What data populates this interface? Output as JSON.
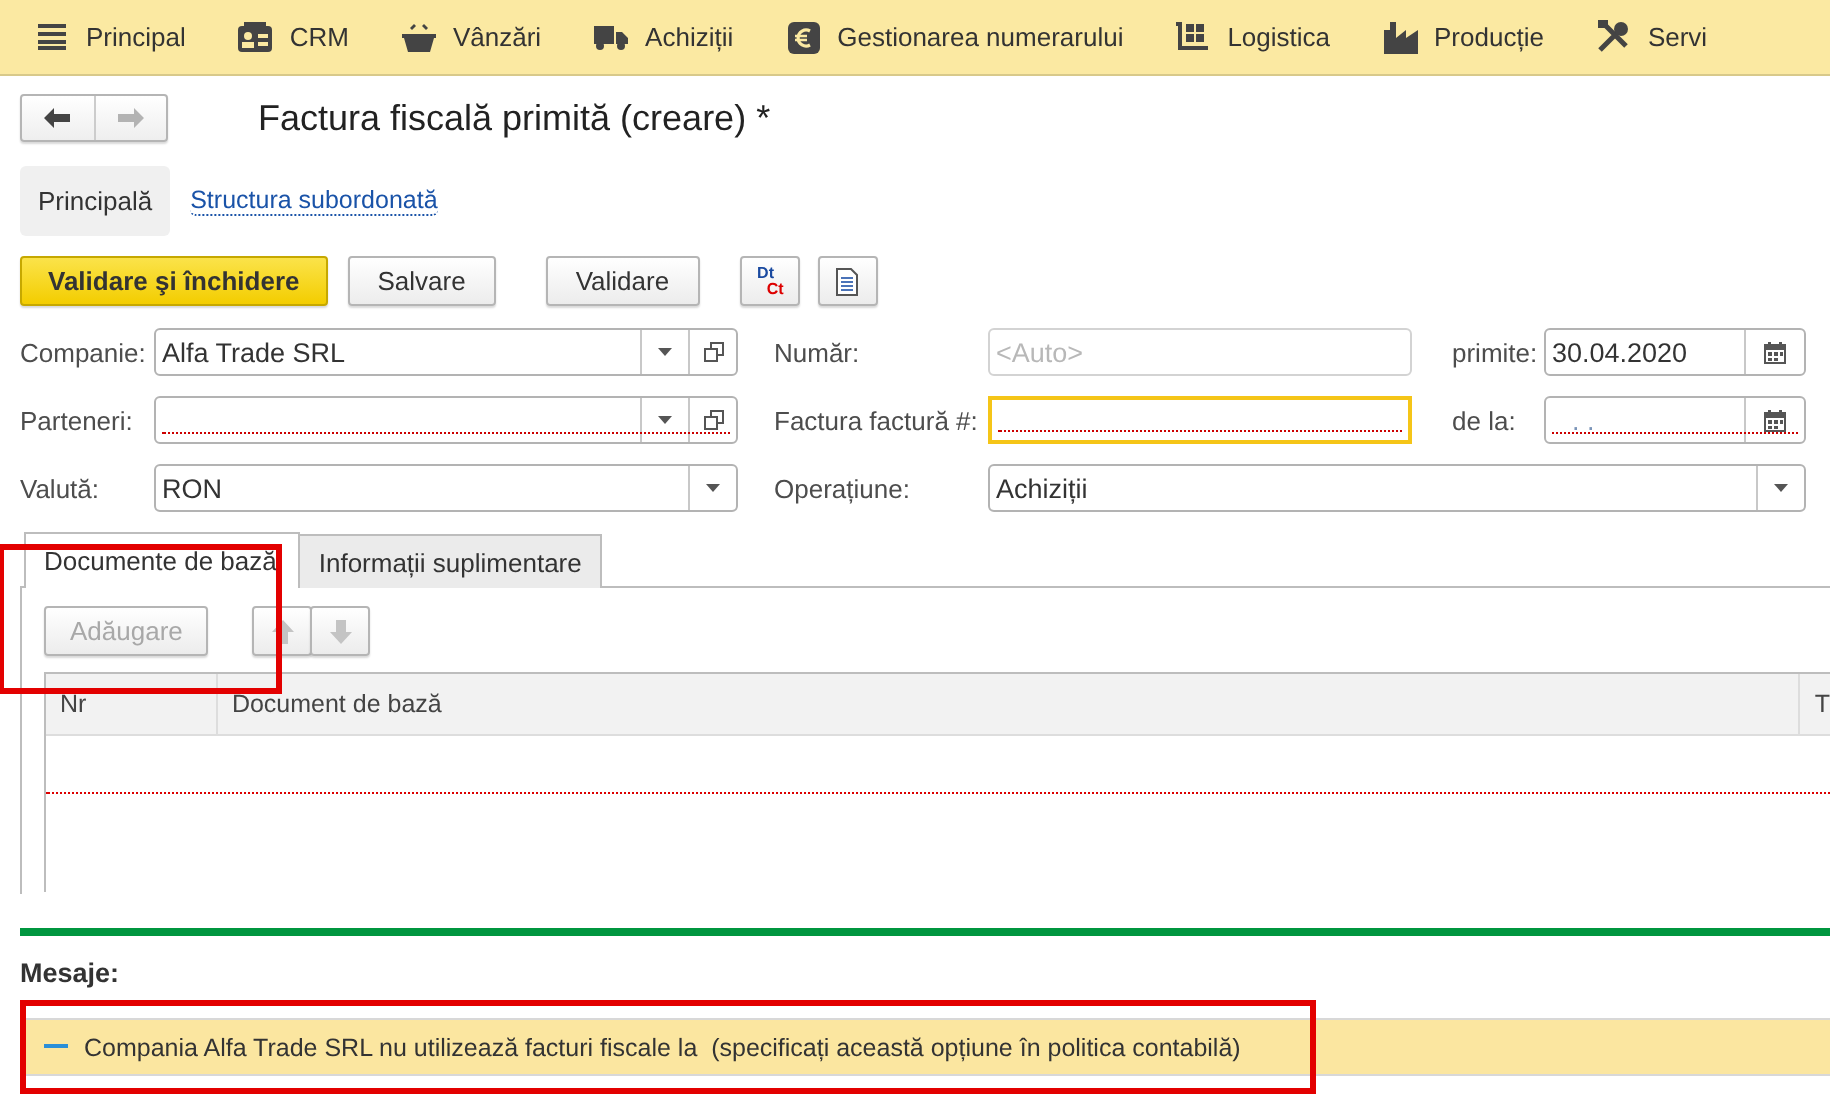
{
  "menu": [
    {
      "label": "Principal"
    },
    {
      "label": "CRM"
    },
    {
      "label": "Vânzări"
    },
    {
      "label": "Achiziții"
    },
    {
      "label": "Gestionarea numerarului"
    },
    {
      "label": "Logistica"
    },
    {
      "label": "Producție"
    },
    {
      "label": "Servi"
    }
  ],
  "navigation": {
    "back_enabled": true,
    "forward_enabled": false
  },
  "title": "Factura fiscală primită (creare) *",
  "sections": [
    {
      "label": "Principală",
      "selected": true
    },
    {
      "label": "Structura subordonată",
      "selected": false
    }
  ],
  "toolbar": [
    {
      "kind": "primary",
      "label": "Validare şi închidere"
    },
    {
      "kind": "default",
      "label": "Salvare"
    },
    {
      "kind": "default",
      "label": "Validare"
    },
    {
      "kind": "debit-credit",
      "labels": [
        "Dt",
        "Ct"
      ]
    },
    {
      "kind": "report"
    }
  ],
  "form_rows": [
    [
      {
        "label": "Companie:",
        "value": "Alfa Trade SRL",
        "dropdown": true,
        "open_button": true
      },
      {
        "label": "Număr:",
        "placeholder": "<Auto>",
        "disabled": true
      },
      {
        "label": "primite:",
        "value": "30.04.2020",
        "calendar": true
      }
    ],
    [
      {
        "label": "Parteneri:",
        "dropdown": true,
        "open_button": true,
        "required": true
      },
      {
        "label": "Factura factură #:",
        "required": true,
        "focused": true
      },
      {
        "label": "de la:",
        "value": ". .",
        "calendar": true,
        "required": true,
        "empty_mask": true
      }
    ],
    [
      {
        "label": "Valută:",
        "value": "RON",
        "dropdown": true
      },
      {
        "label": "Operațiune:",
        "value": "Achiziții",
        "dropdown": true
      }
    ]
  ],
  "tabs": {
    "highlighted": true,
    "items": [
      {
        "label": "Documente de bază",
        "selected": true
      },
      {
        "label": "Informații suplimentare",
        "selected": false
      }
    ]
  },
  "table_toolbar": {
    "add": {
      "label": "Adăugare",
      "disabled": true
    },
    "move_up": {
      "disabled": true
    },
    "move_down": {
      "disabled": true
    }
  },
  "table": {
    "columns": [
      "Nr",
      "Document de bază",
      "T"
    ],
    "required": true
  },
  "messages": {
    "title": "Mesaje:",
    "items": [
      {
        "text": "Compania Alfa Trade SRL nu utilizează facturi fiscale la  (specificați această opțiune în politica contabilă)",
        "highlighted": true
      }
    ]
  }
}
